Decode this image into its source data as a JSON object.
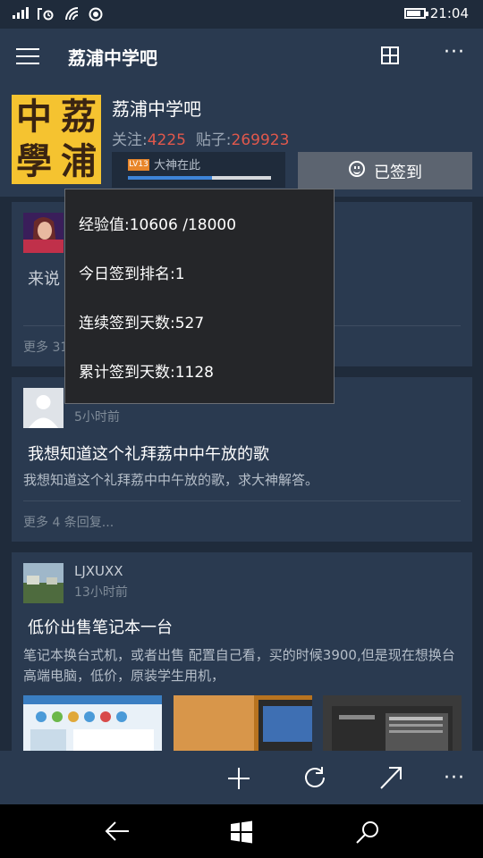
{
  "status_bar": {
    "time": "21:04",
    "battery_level": 0.85
  },
  "header": {
    "title": "荔浦中学吧"
  },
  "forum": {
    "logo_text": [
      "中",
      "荔",
      "學",
      "浦"
    ],
    "name": "荔浦中学吧",
    "follow_label": "关注:",
    "follow_count": "4225",
    "posts_label": "贴子:",
    "posts_count": "269923",
    "level_badge": "LV13",
    "level_title": "大神在此",
    "level_progress": 0.589,
    "signed_label": "已签到"
  },
  "popup": {
    "exp": "经验值:10606 /18000",
    "rank": "今日签到排名:1",
    "streak": "连续签到天数:527",
    "total": "累计签到天数:1128"
  },
  "posts": [
    {
      "title": "来说",
      "replies": "更多 31"
    },
    {
      "author": "",
      "time": "5小时前",
      "title": "我想知道这个礼拜荔中中午放的歌",
      "body": "我想知道这个礼拜荔中中午放的歌，求大神解答。",
      "replies": "更多 4 条回复..."
    },
    {
      "author": "LJXUXX",
      "time": "13小时前",
      "title": "低价出售笔记本一台",
      "body": "笔记本换台式机，或者出售 配置自己看，买的时候3900,但是现在想换台高端电脑，低价，原装学生用机，"
    }
  ],
  "colors": {
    "background": "#1f2b3b",
    "panel": "#2a3a50",
    "accent": "#3e84d8",
    "stat_number": "#e0584c",
    "level_badge": "#e8862b"
  },
  "icons": {
    "appbar": [
      "add-icon",
      "refresh-icon",
      "share-icon",
      "more-icon"
    ],
    "navbar": [
      "back-icon",
      "windows-icon",
      "search-icon"
    ]
  }
}
